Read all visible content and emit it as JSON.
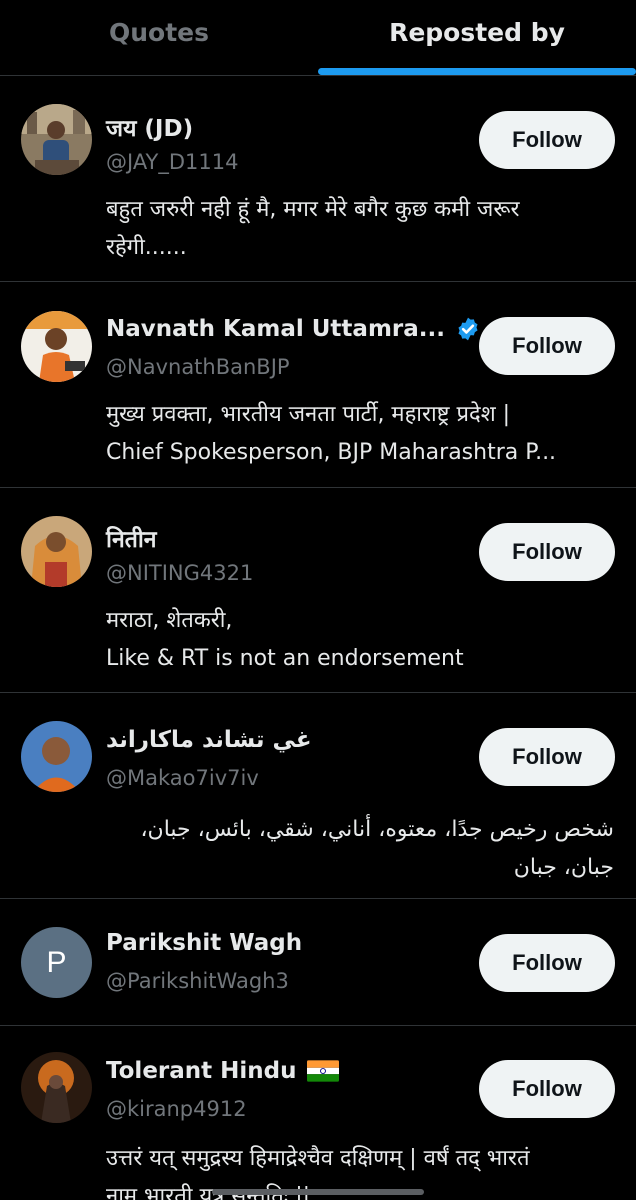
{
  "tabs": [
    {
      "label": "Quotes",
      "active": false
    },
    {
      "label": "Reposted by",
      "active": true
    }
  ],
  "accent_color": "#1d9bf0",
  "follow_label": "Follow",
  "users": [
    {
      "name": "जय (JD)",
      "handle": "@JAY_D1114",
      "bio": [
        "बहुत जरुरी नही हूं मै, मगर मेरे बगैर कुछ कमी जरूर",
        "रहेगी......"
      ],
      "verified": false
    },
    {
      "name": "Navnath Kamal Uttamra...",
      "handle": "@NavnathBanBJP",
      "bio": [
        "मुख्य प्रवक्ता, भारतीय जनता पार्टी, महाराष्ट्र प्रदेश |",
        "Chief Spokesperson, BJP Maharashtra P..."
      ],
      "verified": true
    },
    {
      "name": "नितीन",
      "handle": "@NITING4321",
      "bio": [
        "मराठा, शेतकरी,",
        "Like & RT is not an endorsement"
      ],
      "verified": false
    },
    {
      "name": "غي تشاند ماكاراند",
      "handle": "@Makao7iv7iv",
      "bio": [
        "شخص رخيص جدًا، معتوه، أناني، شقي، بائس، جبان،",
        "جبان، جبان"
      ],
      "verified": false
    },
    {
      "name": "Parikshit Wagh",
      "handle": "@ParikshitWagh3",
      "bio": [],
      "verified": false,
      "avatar_letter": "P"
    },
    {
      "name": "Tolerant Hindu",
      "handle": "@kiranp4912",
      "bio": [
        "उत्तरं यत् समुद्रस्य हिमाद्रेश्चैव दक्षिणम् | वर्षं तद् भारतं",
        "नाम भारती यत्र सन्ततिः ||"
      ],
      "verified": false,
      "flag": "india-flag-icon"
    }
  ]
}
